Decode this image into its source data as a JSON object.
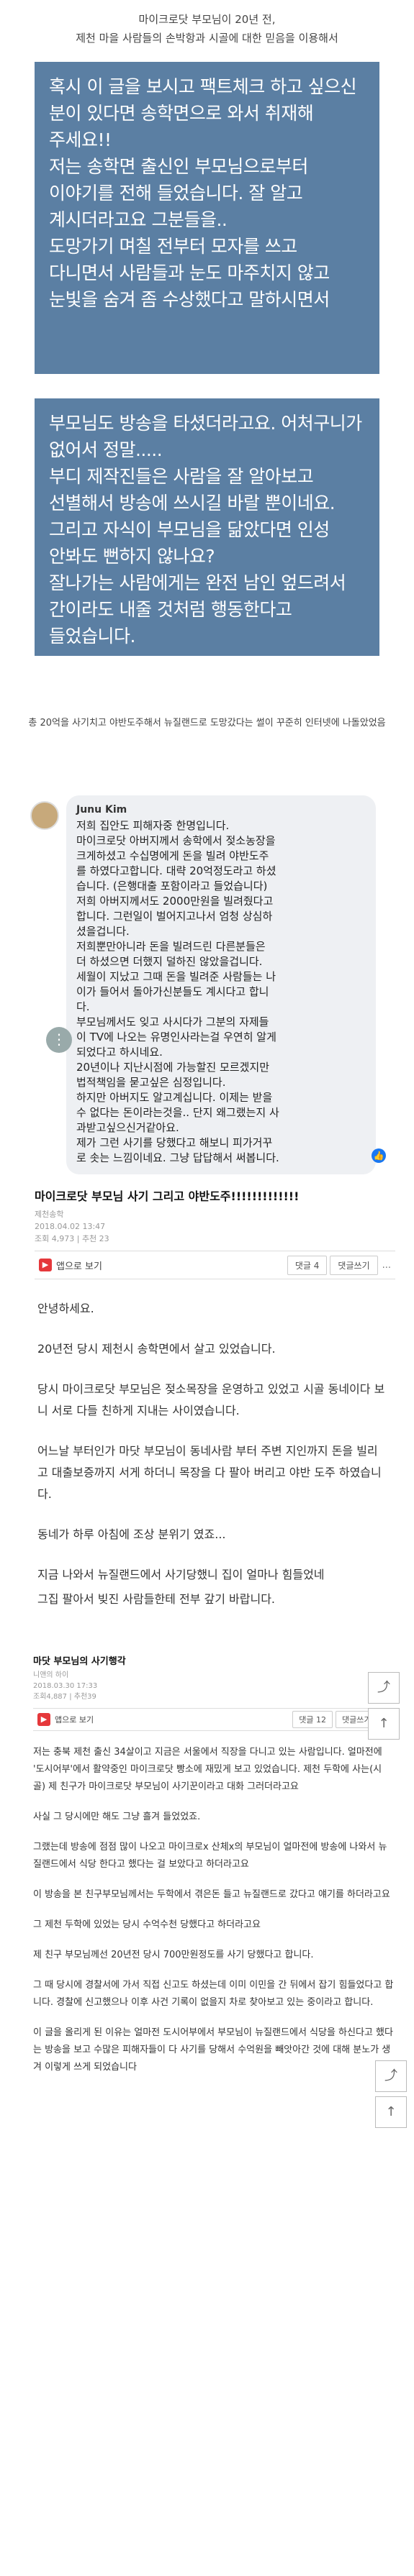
{
  "header": {
    "line1": "마이크로닷 부모님이 20년 전,",
    "line2": "제천 마을 사람들의 손박항과 시골에 대한 믿음을 이용해서"
  },
  "quote1": {
    "lines": [
      "혹시 이 글을 보시고 팩트체크 하고 싶으신",
      "분이 있다면 송학면으로 와서 취재해",
      "주세요!!",
      "저는 송학면 출신인 부모님으로부터",
      "이야기를 전해 들었습니다. 잘 알고",
      "계시더라고요 그분들을..",
      "도망가기 며칠 전부터 모자를 쓰고",
      "다니면서 사람들과 눈도 마주치지 않고",
      "눈빛을 숨겨 좀 수상했다고 말하시면서"
    ]
  },
  "quote2": {
    "lines": [
      "부모님도 방송을 타셨더라고요. 어처구니가",
      "없어서 정말.....",
      "부디 제작진들은 사람을 잘 알아보고",
      "선별해서 방송에 쓰시길 바랄 뿐이네요.",
      "그리고 자식이 부모님을 닮았다면 인성",
      "안봐도 뻔하지 않나요?",
      "잘나가는 사람에게는 완전 남인 엎드려서",
      "간이라도 내줄 것처럼 행동한다고",
      "들었습니다."
    ]
  },
  "caption": {
    "text": "총 20억을 사기치고 야반도주해서 뉴질랜드로 도망갔다는 썰이 꾸준히 인터넷에 나돌았었음"
  },
  "facebook": {
    "name": "Junu Kim",
    "lines": [
      "저희 집안도 피해자중 한명입니다.",
      "마이크로닷 아버지께서 송학에서 젖소농장을",
      "크게하셨고 수십명에게 돈을 빌려 야반도주",
      "를 하였다고합니다. 대략 20억정도라고 하셨",
      "습니다. (은행대출 포함이라고 들었습니다)",
      "저희 아버지께서도 2000만원을 빌려줬다고",
      "합니다. 그런일이 벌어지고나서 엄청 상심하",
      "셨을겁니다.",
      "저희뿐만아니라 돈을 빌려드린 다른분들은",
      "더 하셨으면 더했지 덜하진 않았을겁니다.",
      "세월이 지났고 그때 돈을 빌려준 사람들는 나",
      "이가 들어서 돌아가신분들도 계시다고 합니",
      "다.",
      "부모님께서도 잊고 사시다가 그분의 자제들",
      "이 TV에 나오는 유명인사라는걸 우연히 알게",
      "되었다고 하시네요.",
      "20년이나 지난시점에 가능할진 모르겠지만",
      "법적책임을 묻고싶은 심정입니다.",
      "하지만 아버지도 알고계십니다. 이제는 받을",
      "수 없다는 돈이라는것을.. 단지 왜그랬는지 사",
      "과받고싶으신거같아요.",
      "제가 그런 사기를 당했다고 해보니 피가거꾸",
      "로 솟는 느낌이네요. 그냥 답답해서 써봅니다."
    ],
    "more_icon": "more-icon",
    "like_icon": "like-icon"
  },
  "post1": {
    "title": "마이크로닷 부모님 사기 그리고 야반도주!!!!!!!!!!!!!",
    "author": "제천송학",
    "date": "2018.04.02 13:47",
    "views": "조회 4,973",
    "recommend": "추천 23",
    "app_label": "앱으로 보기",
    "comment_label": "댓글 4",
    "write_label": "댓글쓰기",
    "more": "...",
    "paras": [
      "안녕하세요.",
      "20년전 당시 제천시 송학면에서 살고 있었습니다.",
      "당시 마이크로닷 부모님은 젖소목장을 운영하고 있었고 시골 동네이다 보니 서로 다들 친하게 지내는 사이였습니다.",
      "어느날 부터인가 마닷 부모님이 동네사람 부터 주변 지인까지 돈을 빌리고 대출보증까지 서게 하더니 목장을 다 팔아 버리고 야반 도주 하였습니다.",
      "동네가 하루 아침에 조상 분위기 였죠...",
      "지금 나와서 뉴질랜드에서 사기당했니 집이 얼마나 힘들었네",
      "그집 팔아서 빚진 사람들한테 전부 갚기 바랍니다."
    ],
    "up_label": "↑",
    "reply_label": "⤴"
  },
  "post2": {
    "title": "마닷 부모님의 사기행각",
    "author": "니앤의 하이",
    "date": "2018.03.30 17:33",
    "views": "조회4,887",
    "recommend": "추천39",
    "app_label": "앱으로 보기",
    "comment_label": "댓글 12",
    "write_label": "댓글쓰기",
    "more": "...",
    "paras": [
      "저는 충북 제천 출신 34살이고 지금은 서울에서 직장을 다니고 있는 사람입니다. 얼마전에 '도시어부'에서 활약중인 마이크로닷 빵소에 재밌게 보고 있었습니다. 제천 두학에 사는(시골) 제 친구가 마이크로닷 부모님이 사기꾼이라고 대화 그러더라고요",
      "사실 그 당시에만 해도 그냥 흘겨 들었었죠.",
      "그랬는데 방송에 점점 많이 나오고 마이크로x 산체x의 부모님이 얼마전에 방송에 나와서 뉴질랜드에서 식당 한다고 했다는 걸 보았다고 하더라고요",
      "이 방송을 본 친구부모님께서는 두학에서 겪은돈 들고 뉴질랜드로 갔다고 얘기를 하더라고요",
      "그 제천 두학에 있었는 당시 수억수천 당했다고 하더라고요",
      "제 친구 부모님께선 20년전 당시 700만원정도를 사기 당했다고 합니다.",
      "그 때 당시에 경찰서에 가서 직접 신고도 하셨는데 이미 이민을 간 뒤에서 잡기 힘들었다고 합니다. 경찰에 신고했으나 이후 사건 기록이 없을지 차로 찾아보고 있는 중이라고 합니다.",
      "이 글을 올리게 된 이유는 얼마전 도시어부에서 부모님이 뉴질랜드에서 식당을 하신다고 했다는 방송을 보고 수많은 피해자들이 다 사기를 당해서 수억원을 빼앗아간 것에 대해 분노가 생겨 이렇게 쓰게 되었습니다"
    ],
    "up_label": "↑",
    "reply_label": "⤴"
  }
}
